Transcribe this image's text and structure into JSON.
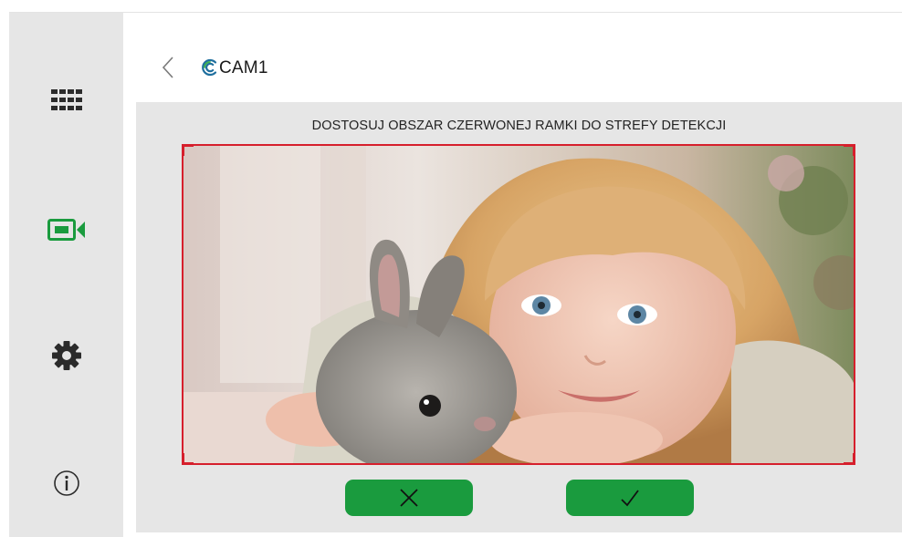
{
  "header": {
    "camera_name": "CAM1"
  },
  "sidebar": {
    "items": [
      {
        "id": "menu",
        "icon": "grid-menu-icon",
        "active": false
      },
      {
        "id": "camera",
        "icon": "video-camera-icon",
        "active": true
      },
      {
        "id": "settings",
        "icon": "gear-icon",
        "active": false
      },
      {
        "id": "info",
        "icon": "info-icon",
        "active": false
      }
    ]
  },
  "main": {
    "instruction": "DOSTOSUJ OBSZAR CZERWONEJ RAMKI DO STREFY DETEKCJI",
    "actions": [
      {
        "id": "cancel",
        "icon": "close-icon"
      },
      {
        "id": "confirm",
        "icon": "checkmark-icon"
      }
    ]
  },
  "colors": {
    "accent_green": "#1a9b3e",
    "detection_frame": "#d61f2c",
    "panel_bg": "#e6e6e6"
  }
}
